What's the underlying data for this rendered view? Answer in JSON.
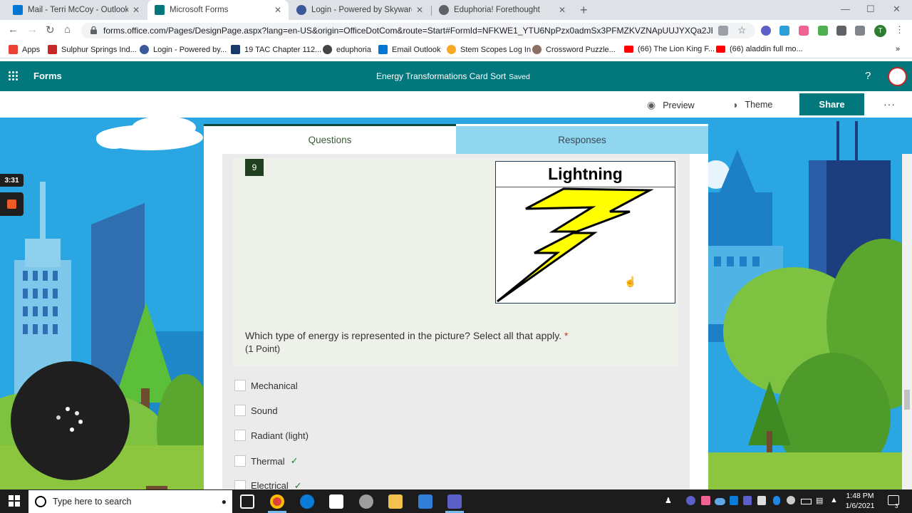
{
  "browser": {
    "tabs": [
      {
        "label": "Mail - Terri McCoy - Outlook",
        "icon": "outlook-icon",
        "color": "#0078d4",
        "active": false
      },
      {
        "label": "Microsoft Forms",
        "icon": "forms-icon",
        "color": "#03787c",
        "active": true
      },
      {
        "label": "Login - Powered by Skyward",
        "icon": "skyward-icon",
        "color": "#3b5998",
        "active": false
      },
      {
        "label": "Eduphoria! Forethought",
        "icon": "globe-icon",
        "color": "#5f6368",
        "active": false
      }
    ],
    "close_glyph": "✕",
    "new_tab_glyph": "+",
    "url": "forms.office.com/Pages/DesignPage.aspx?lang=en-US&origin=OfficeDotCom&route=Start#FormId=NFKWE1_YTU6NpPzx0admSx3PFMZKVZNApUUJYXQa2JBUREV...",
    "profile_initial": "T",
    "bookmarks": [
      {
        "label": "Apps",
        "icon": "apps-grid-icon",
        "color": "#ea4335"
      },
      {
        "label": "Sulphur Springs Ind...",
        "icon": "school-icon",
        "color": "#c62828"
      },
      {
        "label": "Login - Powered by...",
        "icon": "skyward-icon",
        "color": "#3b5998"
      },
      {
        "label": "19 TAC Chapter 112...",
        "icon": "doc-icon",
        "color": "#1a3a6b"
      },
      {
        "label": "eduphoria",
        "icon": "globe-icon",
        "color": "#444"
      },
      {
        "label": "Email Outlook",
        "icon": "outlook-icon",
        "color": "#0078d4"
      },
      {
        "label": "Stem Scopes Log In",
        "icon": "stemscopes-icon",
        "color": "#f9a825"
      },
      {
        "label": "Crossword Puzzle...",
        "icon": "crossword-icon",
        "color": "#8d6e63"
      },
      {
        "label": "(66) The Lion King F...",
        "icon": "youtube-icon",
        "color": "#ff0000"
      },
      {
        "label": "(66) aladdin full mo...",
        "icon": "youtube-icon",
        "color": "#ff0000"
      }
    ],
    "overflow_glyph": "»"
  },
  "forms": {
    "app_name": "Forms",
    "title": "Energy Transformations Card Sort",
    "save_status": "Saved",
    "help_glyph": "?",
    "commands": {
      "preview": "Preview",
      "theme": "Theme",
      "share": "Share",
      "more": "···"
    },
    "tabs": {
      "questions": "Questions",
      "responses": "Responses"
    },
    "question": {
      "number": "9",
      "image_title": "Lightning",
      "text": "Which type of energy is represented in the picture? Select all that apply.",
      "required_mark": "*",
      "points": "(1 Point)",
      "options": [
        {
          "label": "Mechanical",
          "correct": false
        },
        {
          "label": "Sound",
          "correct": false
        },
        {
          "label": "Radiant (light)",
          "correct": false
        },
        {
          "label": "Thermal",
          "correct": true
        },
        {
          "label": "Electrical",
          "correct": true
        }
      ],
      "check_glyph": "✓"
    }
  },
  "recorder": {
    "timer": "3:31"
  },
  "taskbar": {
    "search_placeholder": "Type here to search",
    "time": "1:48 PM",
    "date": "1/6/2021",
    "notification_count": "3"
  },
  "colors": {
    "forms_teal": "#03787c",
    "accent_dark_green": "#204020",
    "responses_tab": "#8fd6ee",
    "sky": "#2aa7e2"
  }
}
